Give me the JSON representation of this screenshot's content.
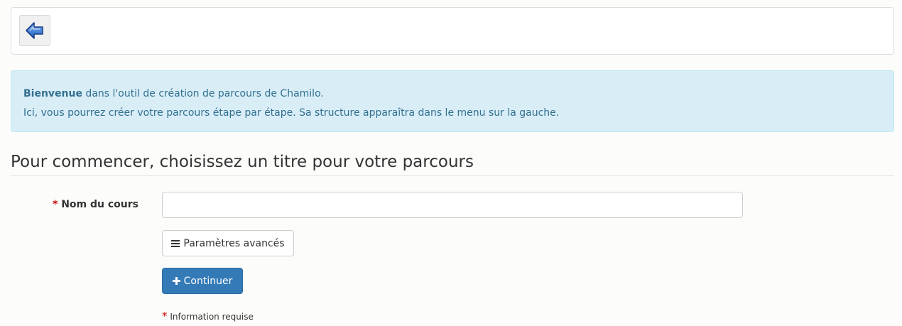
{
  "toolbar": {
    "back_icon": "arrow-left-icon",
    "back_color": "#2a6fd6"
  },
  "welcome": {
    "strong": "Bienvenue",
    "line1_rest": " dans l'outil de création de parcours de Chamilo.",
    "line2": "Ici, vous pourrez créer votre parcours étape par étape. Sa structure apparaîtra dans le menu sur la gauche.",
    "bg_color": "#d9edf7",
    "text_color": "#31708f"
  },
  "section": {
    "title": "Pour commencer, choisissez un titre pour votre parcours"
  },
  "form": {
    "required_mark": "*",
    "course_name_label": "Nom du cours",
    "course_name_value": "",
    "advanced_label": "Paramètres avancés",
    "advanced_icon": "menu-icon",
    "continue_label": "Continuer",
    "continue_icon": "plus-icon",
    "continue_color": "#337ab7",
    "required_note": "Information requise"
  }
}
